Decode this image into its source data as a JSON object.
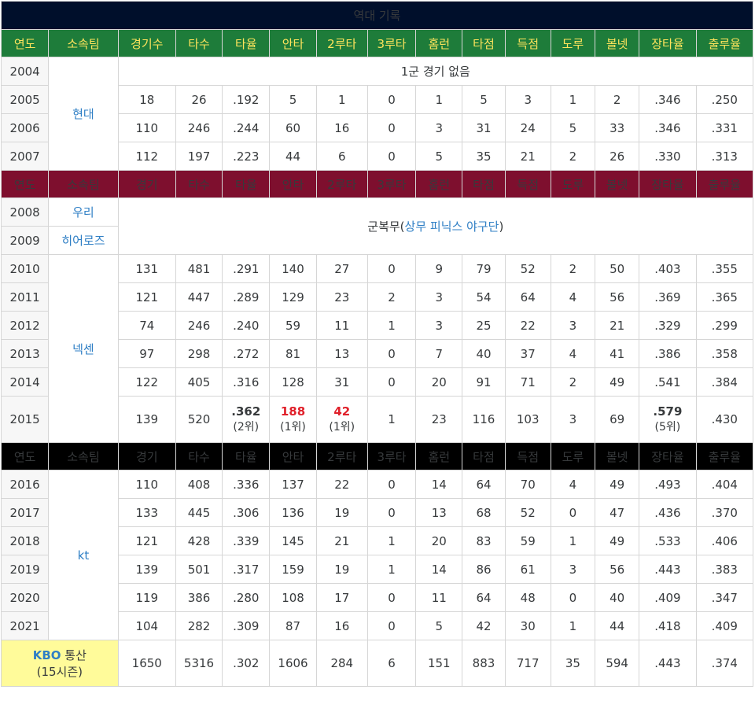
{
  "title": "역대 기록",
  "headers": {
    "green": [
      "연도",
      "소속팀",
      "경기수",
      "타수",
      "타율",
      "안타",
      "2루타",
      "3루타",
      "홈런",
      "타점",
      "득점",
      "도루",
      "볼넷",
      "장타율",
      "출루율"
    ],
    "maroon": [
      "연도",
      "소속팀",
      "경기",
      "타수",
      "타율",
      "안타",
      "2루타",
      "3루타",
      "홈런",
      "타점",
      "득점",
      "도루",
      "볼넷",
      "장타율",
      "출루율"
    ],
    "black": [
      "연도",
      "소속팀",
      "경기",
      "타수",
      "타율",
      "안타",
      "2루타",
      "3루타",
      "홈런",
      "타점",
      "득점",
      "도루",
      "볼넷",
      "장타율",
      "출루율"
    ]
  },
  "section1": {
    "team": "현대",
    "row2004": {
      "year": "2004",
      "note": "1군 경기 없음"
    },
    "rows": [
      {
        "year": "2005",
        "vals": [
          "18",
          "26",
          ".192",
          "5",
          "1",
          "0",
          "1",
          "5",
          "3",
          "1",
          "2",
          ".346",
          ".250"
        ]
      },
      {
        "year": "2006",
        "vals": [
          "110",
          "246",
          ".244",
          "60",
          "16",
          "0",
          "3",
          "31",
          "24",
          "5",
          "33",
          ".346",
          ".331"
        ]
      },
      {
        "year": "2007",
        "vals": [
          "112",
          "197",
          ".223",
          "44",
          "6",
          "0",
          "5",
          "35",
          "21",
          "2",
          "26",
          ".330",
          ".313"
        ]
      }
    ]
  },
  "section2": {
    "team_woori": "우리",
    "team_heroes": "히어로즈",
    "team_nexen": "넥센",
    "military": {
      "year1": "2008",
      "year2": "2009",
      "prefix": "군복무(",
      "link": "상무 피닉스 야구단",
      "suffix": ")"
    },
    "rows": [
      {
        "year": "2010",
        "vals": [
          "131",
          "481",
          ".291",
          "140",
          "27",
          "0",
          "9",
          "79",
          "52",
          "2",
          "50",
          ".403",
          ".355"
        ]
      },
      {
        "year": "2011",
        "vals": [
          "121",
          "447",
          ".289",
          "129",
          "23",
          "2",
          "3",
          "54",
          "64",
          "4",
          "56",
          ".369",
          ".365"
        ]
      },
      {
        "year": "2012",
        "vals": [
          "74",
          "246",
          ".240",
          "59",
          "11",
          "1",
          "3",
          "25",
          "22",
          "3",
          "21",
          ".329",
          ".299"
        ]
      },
      {
        "year": "2013",
        "vals": [
          "97",
          "298",
          ".272",
          "81",
          "13",
          "0",
          "7",
          "40",
          "37",
          "4",
          "41",
          ".386",
          ".358"
        ]
      },
      {
        "year": "2014",
        "vals": [
          "122",
          "405",
          ".316",
          "128",
          "31",
          "0",
          "20",
          "91",
          "71",
          "2",
          "49",
          ".541",
          ".384"
        ]
      }
    ],
    "row2015": {
      "year": "2015",
      "games": "139",
      "ab": "520",
      "avg": ".362",
      "avg_rank": "(2위)",
      "hits": "188",
      "hits_rank": "(1위)",
      "doubles": "42",
      "doubles_rank": "(1위)",
      "triples": "1",
      "hr": "23",
      "rbi": "116",
      "runs": "103",
      "sb": "3",
      "bb": "69",
      "slg": ".579",
      "slg_rank": "(5위)",
      "obp": ".430"
    }
  },
  "section3": {
    "team": "kt",
    "rows": [
      {
        "year": "2016",
        "vals": [
          "110",
          "408",
          ".336",
          "137",
          "22",
          "0",
          "14",
          "64",
          "70",
          "4",
          "49",
          ".493",
          ".404"
        ]
      },
      {
        "year": "2017",
        "vals": [
          "133",
          "445",
          ".306",
          "136",
          "19",
          "0",
          "13",
          "68",
          "52",
          "0",
          "47",
          ".436",
          ".370"
        ]
      },
      {
        "year": "2018",
        "vals": [
          "121",
          "428",
          ".339",
          "145",
          "21",
          "1",
          "20",
          "83",
          "59",
          "1",
          "49",
          ".533",
          ".406"
        ]
      },
      {
        "year": "2019",
        "vals": [
          "139",
          "501",
          ".317",
          "159",
          "19",
          "1",
          "14",
          "86",
          "61",
          "3",
          "56",
          ".443",
          ".383"
        ]
      },
      {
        "year": "2020",
        "vals": [
          "119",
          "386",
          ".280",
          "108",
          "17",
          "0",
          "11",
          "64",
          "48",
          "0",
          "40",
          ".409",
          ".347"
        ]
      },
      {
        "year": "2021",
        "vals": [
          "104",
          "282",
          ".309",
          "87",
          "16",
          "0",
          "5",
          "42",
          "30",
          "1",
          "44",
          ".418",
          ".409"
        ]
      }
    ]
  },
  "total": {
    "kbo": "KBO",
    "label": " 통산",
    "seasons": "(15시즌)",
    "vals": [
      "1650",
      "5316",
      ".302",
      "1606",
      "284",
      "6",
      "151",
      "883",
      "717",
      "35",
      "594",
      ".443",
      ".374"
    ]
  }
}
